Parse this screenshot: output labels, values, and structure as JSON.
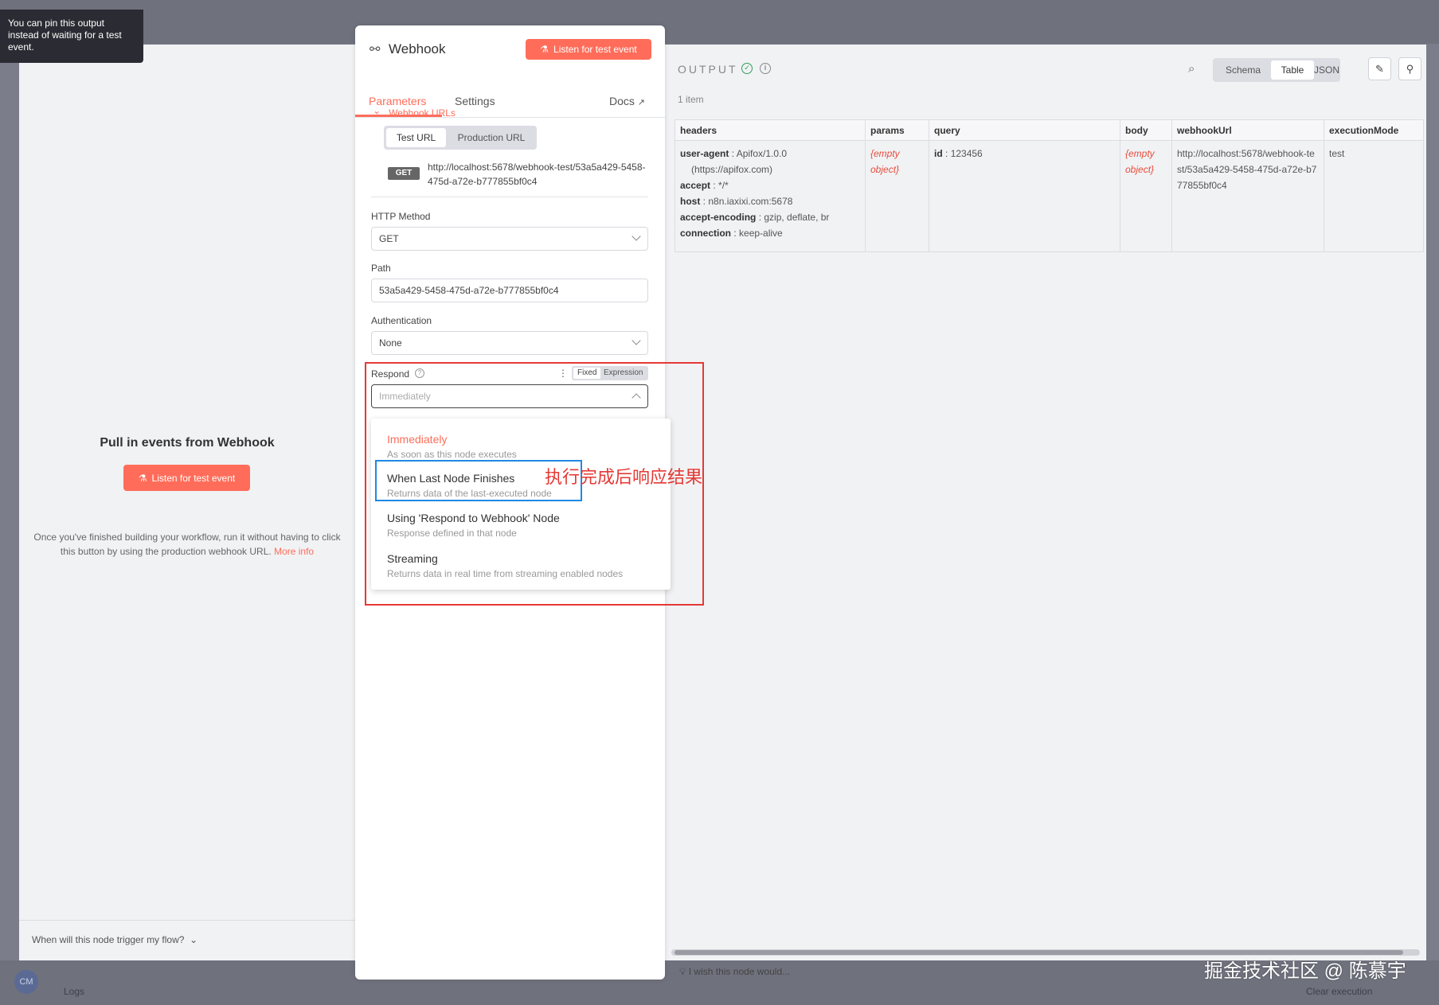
{
  "tooltip": {
    "text": "You can pin this output instead of waiting for a test event."
  },
  "left": {
    "title": "Pull in events from Webhook",
    "listen_button": "Listen for test event",
    "description": "Once you've finished building your workflow, run it without having to click this button by using the production webhook URL.",
    "more_info": "More info",
    "footer_question": "When will this node trigger my flow?"
  },
  "node": {
    "title": "Webhook",
    "listen_button": "Listen for test event",
    "tabs": [
      "Parameters",
      "Settings"
    ],
    "docs": "Docs",
    "webhook_urls_label": "Webhook URLs",
    "url_tabs": [
      "Test URL",
      "Production URL"
    ],
    "method_badge": "GET",
    "url": "http://localhost:5678/webhook-test/53a5a429-5458-475d-a72e-b777855bf0c4",
    "http_method_label": "HTTP Method",
    "http_method_value": "GET",
    "path_label": "Path",
    "path_value": "53a5a429-5458-475d-a72e-b777855bf0c4",
    "auth_label": "Authentication",
    "auth_value": "None",
    "respond_label": "Respond",
    "fixed_label": "Fixed",
    "expression_label": "Expression",
    "respond_placeholder": "Immediately",
    "respond_options": [
      {
        "title": "Immediately",
        "subtitle": "As soon as this node executes"
      },
      {
        "title": "When Last Node Finishes",
        "subtitle": "Returns data of the last-executed node"
      },
      {
        "title": "Using 'Respond to Webhook' Node",
        "subtitle": "Response defined in that node"
      },
      {
        "title": "Streaming",
        "subtitle": "Returns data in real time from streaming enabled nodes"
      }
    ]
  },
  "annotation": {
    "text": "执行完成后响应结果"
  },
  "output": {
    "label": "OUTPUT",
    "items_count": "1 item",
    "views": [
      "Schema",
      "Table",
      "JSON"
    ],
    "columns": [
      "headers",
      "params",
      "query",
      "body",
      "webhookUrl",
      "executionMode"
    ],
    "headers": [
      {
        "key": "user-agent",
        "value": "Apifox/1.0.0"
      },
      {
        "key": "",
        "value": "(https://apifox.com)"
      },
      {
        "key": "accept",
        "value": "*/*"
      },
      {
        "key": "host",
        "value": "n8n.iaxixi.com:5678"
      },
      {
        "key": "accept-encoding",
        "value": "gzip, deflate, br"
      },
      {
        "key": "connection",
        "value": "keep-alive"
      }
    ],
    "params_value": "{empty object}",
    "query_key": "id",
    "query_value": "123456",
    "body_value": "{empty object}",
    "webhook_url_value": "http://localhost:5678/webhook-test/53a5a429-5458-475d-a72e-b777855bf0c4",
    "execution_mode_value": "test",
    "feedback": "I wish this node would..."
  },
  "background": {
    "avatar": "CM",
    "logs": "Logs",
    "clear_execution": "Clear execution"
  },
  "watermark": "掘金技术社区 @ 陈慕宇",
  "colors": {
    "accent": "#ff6d5a",
    "highlight_red": "#e53935",
    "highlight_blue": "#1e88e5",
    "success": "#2e9e5a"
  }
}
